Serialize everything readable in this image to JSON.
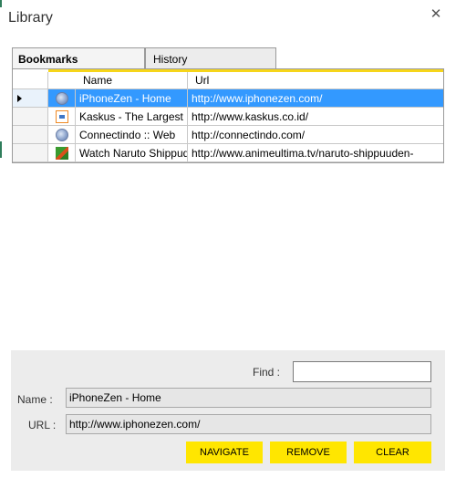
{
  "window": {
    "title": "Library",
    "close_glyph": "✕"
  },
  "tabs": [
    {
      "label": "Bookmarks",
      "active": true
    },
    {
      "label": "History",
      "active": false
    }
  ],
  "grid": {
    "columns": [
      "Name",
      "Url"
    ],
    "rows": [
      {
        "icon": "globe-icon",
        "name": "iPhoneZen - Home",
        "url": "http://www.iphonezen.com/",
        "selected": true
      },
      {
        "icon": "kaskus-favicon",
        "name": "Kaskus - The Largest",
        "url": "http://www.kaskus.co.id/",
        "selected": false
      },
      {
        "icon": "globe-icon",
        "name": "Connectindo :: Web",
        "url": "http://connectindo.com/",
        "selected": false
      },
      {
        "icon": "naruto-favicon",
        "name": "Watch Naruto Shippuden",
        "url": "http://www.animeultima.tv/naruto-shippuuden-",
        "selected": false
      }
    ]
  },
  "details": {
    "find_label": "Find :",
    "find_value": "",
    "name_label": "Name :",
    "name_value": "iPhoneZen - Home",
    "url_label": "URL :",
    "url_value": "http://www.iphonezen.com/"
  },
  "buttons": {
    "navigate": "NAVIGATE",
    "remove": "REMOVE",
    "clear": "CLEAR"
  },
  "colors": {
    "accent_yellow": "#ffe600",
    "selection_blue": "#3399ff"
  }
}
